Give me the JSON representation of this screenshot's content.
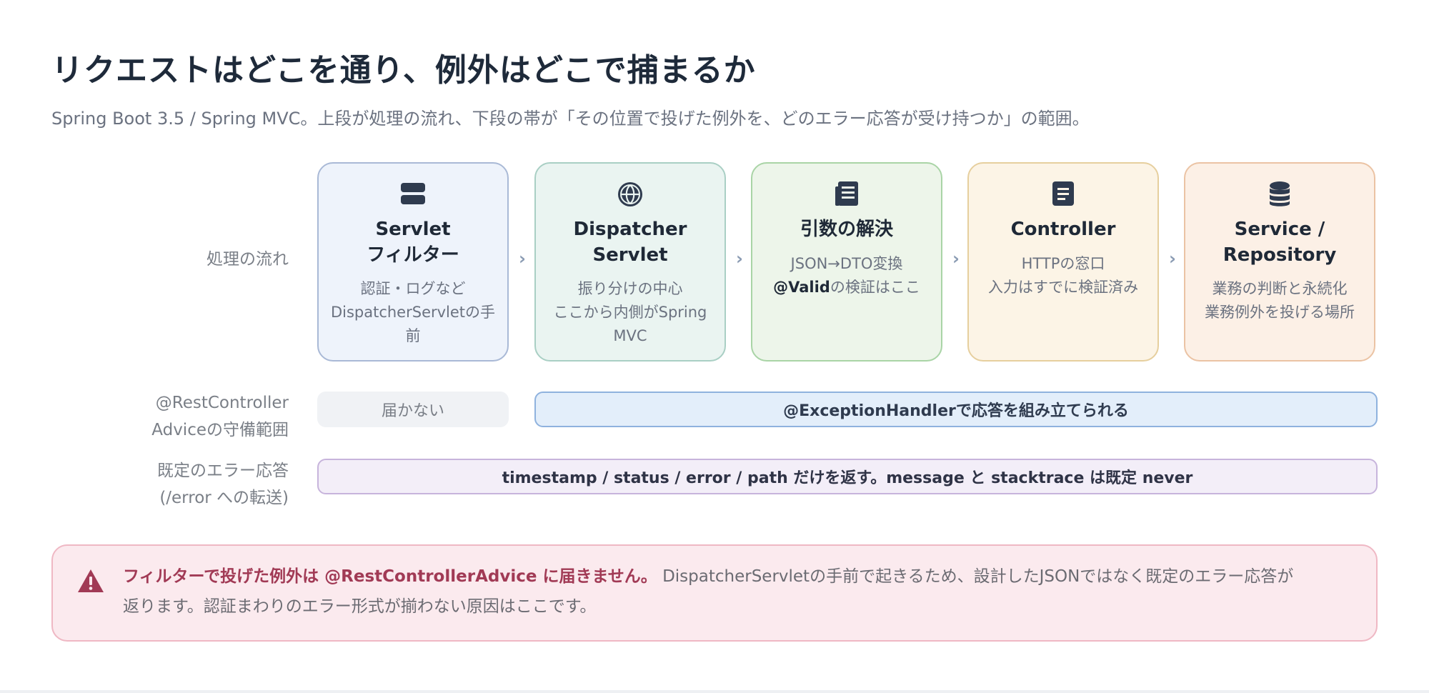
{
  "title": "リクエストはどこを通り、例外はどこで捕まるか",
  "subtitle": "Spring Boot 3.5 / Spring MVC。上段が処理の流れ、下段の帯が「その位置で投げた例外を、どのエラー応答が受け持つか」の範囲。",
  "row_labels": {
    "flow": "処理の流れ",
    "advice_line1": "@RestController",
    "advice_line2": "Adviceの守備範囲",
    "default_line1": "既定のエラー応答",
    "default_line2": "(/error への転送)"
  },
  "stages": [
    {
      "icon": "server-icon",
      "name_line1": "Servlet",
      "name_line2": "フィルター",
      "desc_line1": "認証・ログなど",
      "desc_line2": "DispatcherServletの手",
      "desc_line3": "前",
      "accent": "#a9b9d6",
      "bg": "#eef3fb"
    },
    {
      "icon": "globe-icon",
      "name_line1": "Dispatcher",
      "name_line2": "Servlet",
      "desc_line1": "振り分けの中心",
      "desc_line2": "ここから内側がSpring",
      "desc_line3": "MVC",
      "accent": "#a9cfc4",
      "bg": "#eaf4f1"
    },
    {
      "icon": "document-icon",
      "name_line1": "引数の解決",
      "desc_line1": "JSON→DTO変換",
      "desc_bold": "@Valid",
      "desc_line2_rest": "の検証はここ",
      "accent": "#a9d4a6",
      "bg": "#edf5ea"
    },
    {
      "icon": "file-icon",
      "name_line1": "Controller",
      "desc_line1": "HTTPの窓口",
      "desc_line2": "入力はすでに検証済み",
      "accent": "#e6cf9e",
      "bg": "#fcf4e6"
    },
    {
      "icon": "database-icon",
      "name_line1": "Service /",
      "name_line2": "Repository",
      "desc_line1": "業務の判断と永続化",
      "desc_line2": "業務例外を投げる場所",
      "accent": "#ebc3a4",
      "bg": "#fcf0e6"
    }
  ],
  "bands": {
    "not_reached": "届かない",
    "handler": "@ExceptionHandlerで応答を組み立てられる",
    "default": "timestamp / status / error / path だけを返す。message と stacktrace は既定 never"
  },
  "alert": {
    "strong": "フィルターで投げた例外は @RestControllerAdvice に届きません。",
    "rest_line1": " DispatcherServletの手前で起きるため、設計したJSONではなく既定のエラー応答が",
    "line2": "返ります。認証まわりのエラー形式が揃わない原因はここです。",
    "icon": "warning-icon"
  },
  "colors": {
    "title": "#1e2a3a",
    "subtitle": "#6b7280",
    "handler_band_bg": "#e3eefa",
    "handler_band_border": "#8fb2de",
    "default_band_bg": "#f3eef8",
    "default_band_border": "#c7b4dc",
    "not_reached_bg": "#f0f2f5",
    "alert_bg": "#fbeaee",
    "alert_accent": "#a13a55"
  }
}
